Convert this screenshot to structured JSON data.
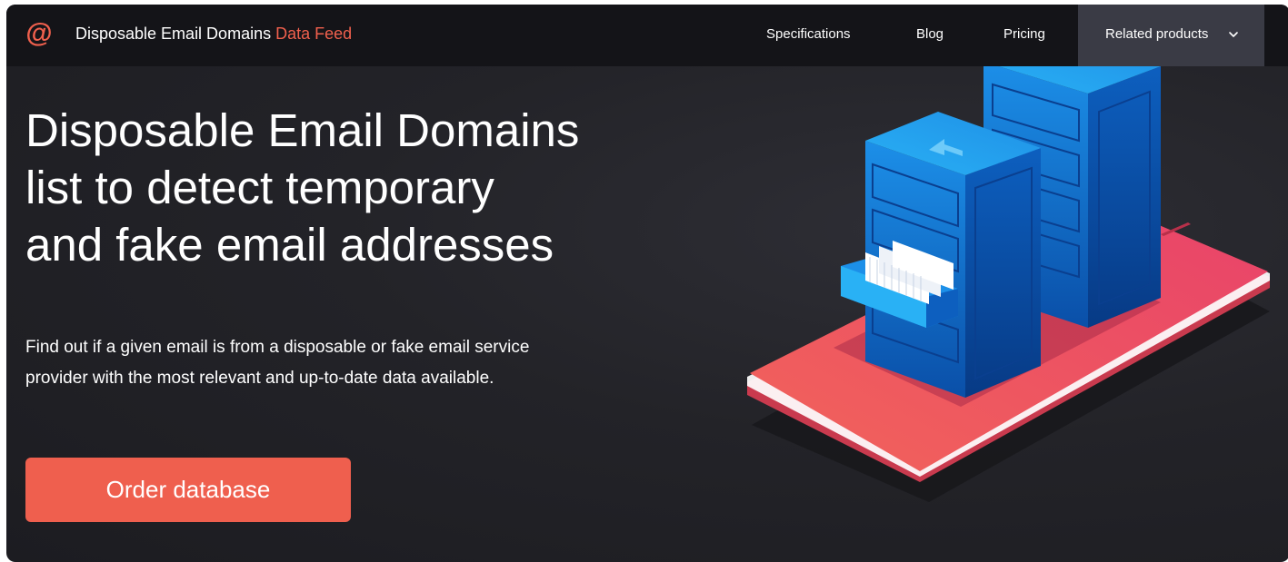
{
  "header": {
    "logo_icon": "at-sign-icon",
    "brand_main": "Disposable Email Domains",
    "brand_accent": "Data Feed",
    "nav": {
      "specifications": "Specifications",
      "blog": "Blog",
      "pricing": "Pricing",
      "related_products": "Related products"
    },
    "dropdown_icon": "chevron-down-icon"
  },
  "hero": {
    "headline_line1": "Disposable Email Domains",
    "headline_line2": "list to detect temporary",
    "headline_line3": "and fake email addresses",
    "lead_line1": "Find out if a given email is from a disposable or fake email service",
    "lead_line2": "provider with the most relevant and up-to-date data available.",
    "cta_label": "Order database",
    "illustration_icon": "server-cabinets-on-phone-illustration"
  },
  "colors": {
    "accent": "#ef5f4e",
    "nav_background": "#141418",
    "hero_background": "#222227",
    "active_nav_background": "#3a3b45",
    "server_blue": "#1479d6"
  }
}
